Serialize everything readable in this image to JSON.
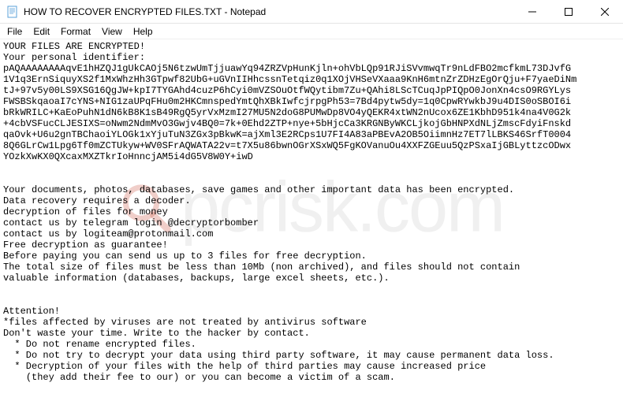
{
  "window": {
    "title": "HOW TO RECOVER ENCRYPTED FILES.TXT - Notepad"
  },
  "menu": {
    "file": "File",
    "edit": "Edit",
    "format": "Format",
    "view": "View",
    "help": "Help"
  },
  "body": {
    "line_encrypted": "YOUR FILES ARE ENCRYPTED!",
    "line_personal_id": "Your personal identifier:",
    "id_block": "pAQAAAAAAAAqvE1hHZQJ1gUkCAOj5N6tzwUmTjjuawYq94ZRZVpHunKjln+ohVbLQp91RJiSVvmwqTr9nLdFBO2mcfkmL73DJvfG\n1V1q3ErnSiquyXS2f1MxWhzHh3GTpwf82UbG+uGVnIIHhcssnTetqiz0q1XOjVHSeVXaaa9KnH6mtnZrZDHzEgOrQju+F7yaeDiNm\ntJ+97v5y00LS9XSG16QgJW+kpI7TYGAhd4cuzP6hCyi0mVZSOuOtfWQytibm7Zu+QAhi8LScTCuqJpPIQpO0JonXn4csO9RGYLys\nFWSBSkqaoaI7cYNS+NIG1zaUPqFHu0m2HKCmnspedYmtQhXBkIwfcjrpgPh53=7Bd4pytw5dy=1q0CpwRYwkbJ9u4DIS0oSBOI6i\nbRkWRILC+KaEoPuhN1dN6kB8K1sB49RgQ5yrVxMzmI27MU5N2doG8PUMwDp8VO4yQEKR4xtWN2nUcox6ZE1KbhD951k4na4V0G2k\n+4cbVSFucCLJESIXS=oNwm2NdmMvO3Gwjv4BQ0=7k+0Ehd2ZTP+nye+5bHjcCa3KRGNByWKCLjkojGbHNPXdNLjZmscFdyiFnskd\nqaOvk+U6u2gnTBChaoiYLOGk1xYjuTuN3ZGx3pBkwK=ajXml3E2RCps1U7FI4A83aPBEvA2OB5OiimnHz7ET7lLBKS46SrfT0004\n8Q6GLrCw1Lpg6Tf0mZCTUkyw+WV0SFrAQWATA22v=t7X5u86bwnOGrXSxWQ5FgKOVanuOu4XXFZGEuu5QzPSxaIjGBLyttzcODwx\nYOzkXwKX0QXcaxMXZTkrIoHnncjAM5i4dG5V8W0Y+iwD",
    "section_main": "Your documents, photos, databases, save games and other important data has been encrypted.\nData recovery requires a decoder.\ndecryption of files for money\ncontact us by telegram login @decryptorbomber\ncontact us by logiteam@protonmail.com\nFree decryption as guarantee!\nBefore paying you can send us up to 3 files for free decryption.\nThe total size of files must be less than 10Mb (non archived), and files should not contain\nvaluable information (databases, backups, large excel sheets, etc.).",
    "section_attention_header": "Attention!",
    "section_attention": "*files affected by viruses are not treated by antivirus software\nDon't waste your time. Write to the hacker by contact.\n  * Do not rename encrypted files.\n  * Do not try to decrypt your data using third party software, it may cause permanent data loss.\n  * Decryption of your files with the help of third parties may cause increased price\n    (they add their fee to our) or you can become a victim of a scam."
  },
  "watermark": {
    "text": "pcrisk.com"
  }
}
